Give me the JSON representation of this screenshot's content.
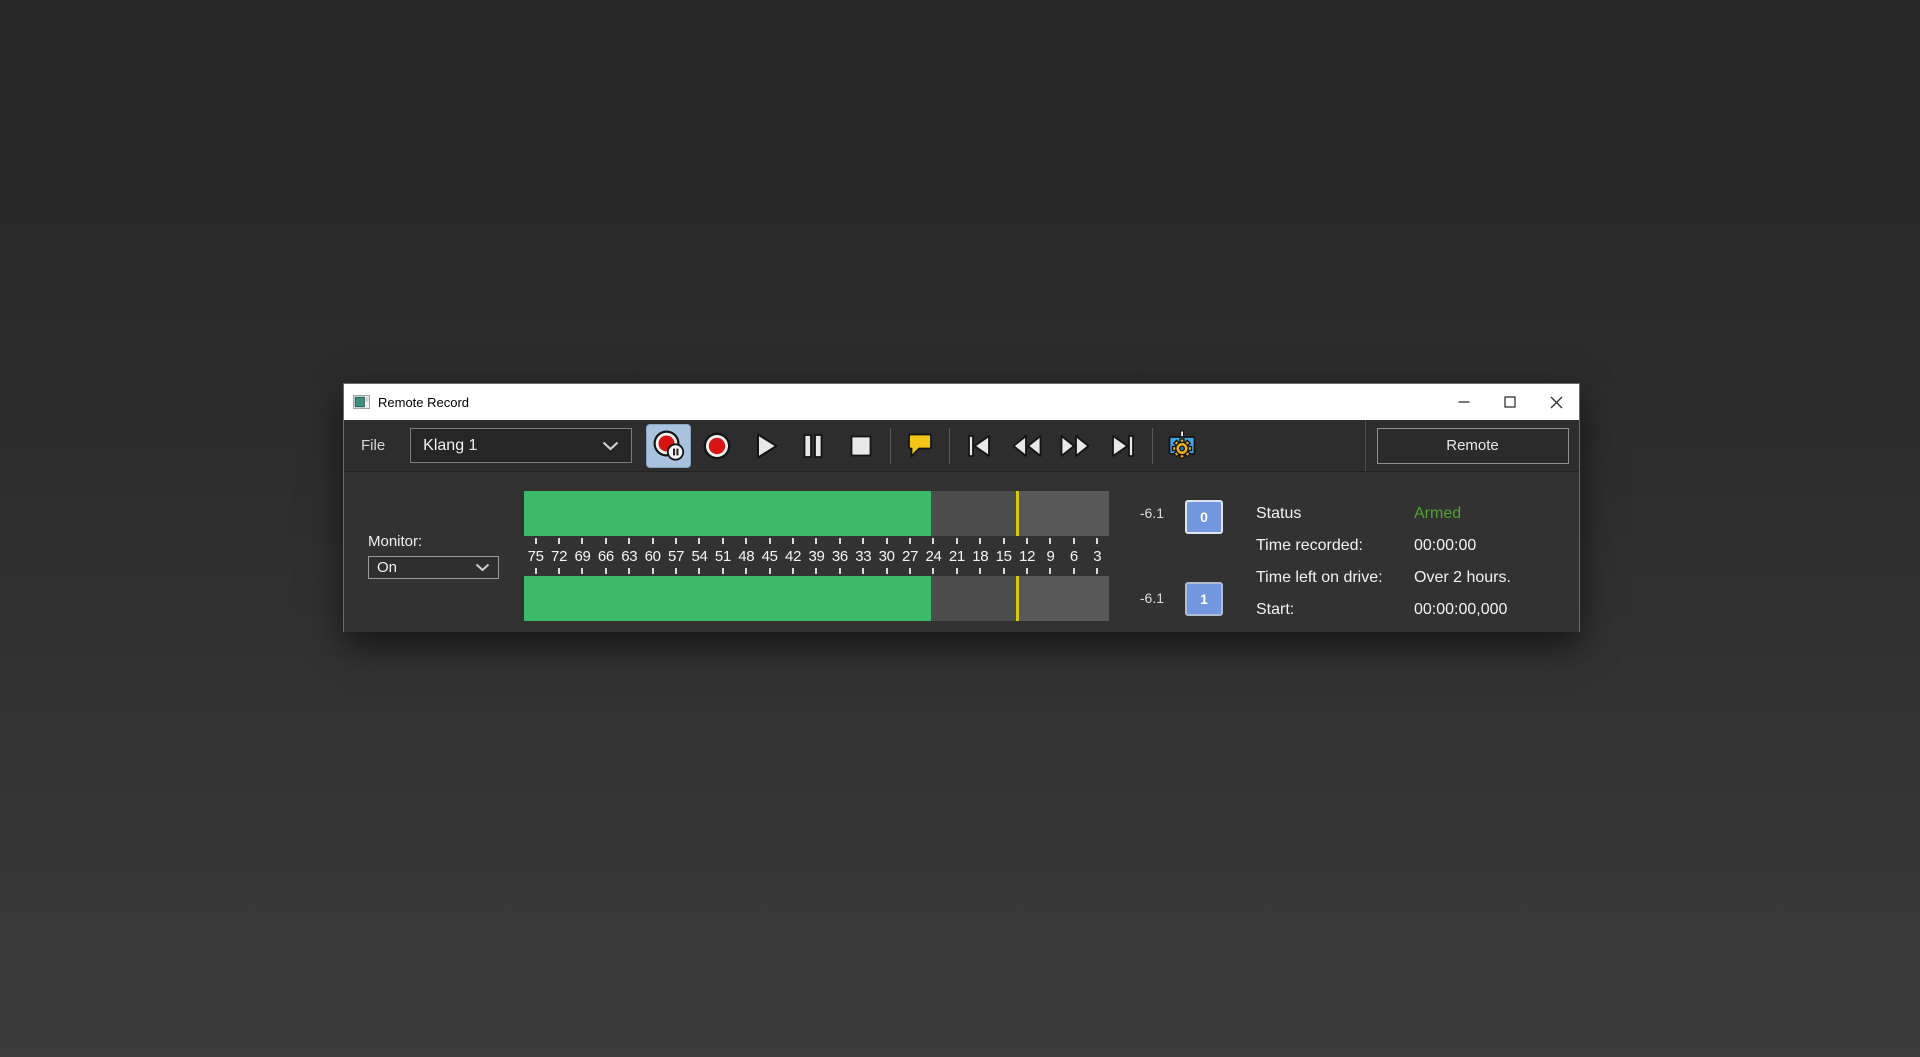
{
  "window": {
    "title": "Remote Record"
  },
  "icons": {
    "app-icon": "🖼",
    "minimize-icon": "—",
    "maximize-icon": "▢",
    "close-icon": "✕",
    "chevron-down-icon": "⌄",
    "record-pause-icon": "⏺⏸",
    "record-icon": "⏺",
    "play-icon": "▶",
    "pause-icon": "⏸",
    "stop-icon": "⏹",
    "drop-marker-icon": "⚑",
    "go-to-start-icon": "⏮",
    "rewind-icon": "⏪",
    "fast-forward-icon": "⏩",
    "go-to-end-icon": "⏭",
    "record-options-icon": "⚙"
  },
  "toolbar": {
    "file_label": "File",
    "file_dropdown_value": "Klang 1",
    "buttons": [
      "record-pause",
      "record",
      "play",
      "pause",
      "stop",
      "drop-marker",
      "go-to-start",
      "rewind",
      "fast-forward",
      "go-to-end",
      "record-options"
    ],
    "remote_button_label": "Remote"
  },
  "monitor": {
    "label": "Monitor:",
    "value": "On"
  },
  "meters": {
    "scale": [
      "75",
      "72",
      "69",
      "66",
      "63",
      "60",
      "57",
      "54",
      "51",
      "48",
      "45",
      "42",
      "39",
      "36",
      "33",
      "30",
      "27",
      "24",
      "21",
      "18",
      "15",
      "12",
      "9",
      "6",
      "3"
    ],
    "level_pct": 69.5,
    "peak_line_pct": 84.2,
    "channels": [
      {
        "id": "0",
        "peak_db": "-6.1"
      },
      {
        "id": "1",
        "peak_db": "-6.1"
      }
    ],
    "colors": {
      "level": "#3dba68",
      "background": "#4c4c4c",
      "peak_line": "#d9c70e",
      "channel_button": "#7297de"
    }
  },
  "status": {
    "rows": [
      {
        "label": "Status",
        "value": "Armed",
        "value_color": "#4fa32e"
      },
      {
        "label": "Time recorded:",
        "value": "00:00:00"
      },
      {
        "label": "Time left on drive:",
        "value": "Over 2 hours."
      },
      {
        "label": "Start:",
        "value": "00:00:00,000"
      }
    ]
  }
}
